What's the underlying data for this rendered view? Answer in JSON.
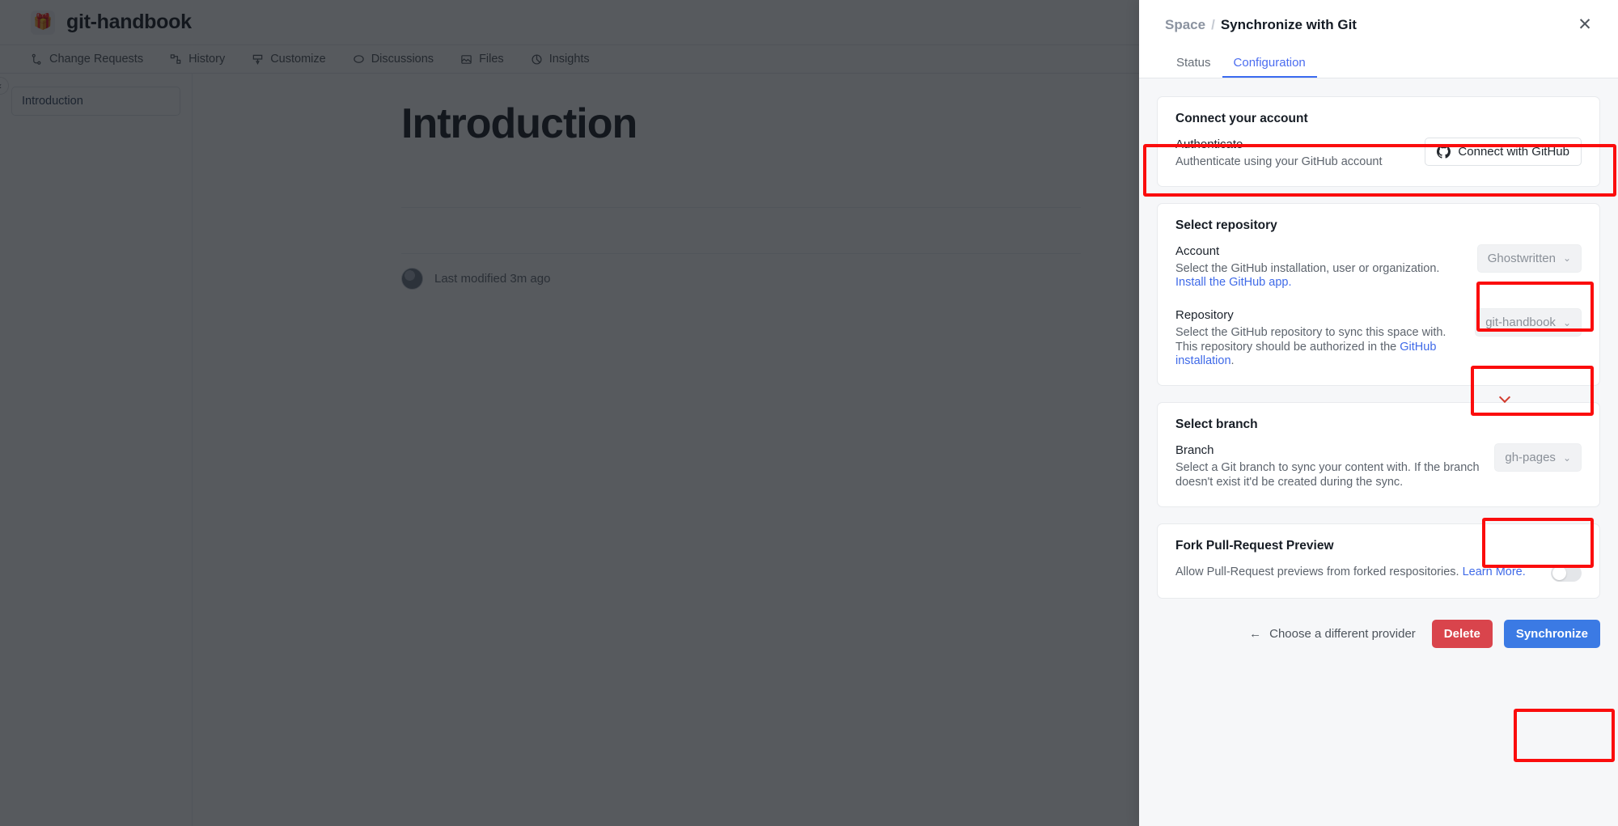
{
  "app": {
    "space_emoji": "🎁",
    "space_title": "git-handbook",
    "collapse_icon": "chevron-left-icon",
    "nav": [
      {
        "label": "Change Requests",
        "icon": "git-branch-icon"
      },
      {
        "label": "History",
        "icon": "history-nodes-icon"
      },
      {
        "label": "Customize",
        "icon": "paint-roller-icon"
      },
      {
        "label": "Discussions",
        "icon": "chat-bubble-icon"
      },
      {
        "label": "Files",
        "icon": "image-file-icon"
      },
      {
        "label": "Insights",
        "icon": "pie-chart-icon"
      }
    ],
    "sidebar": {
      "items": [
        {
          "label": "Introduction"
        }
      ]
    },
    "document": {
      "title": "Introduction",
      "last_modified": "Last modified 3m ago"
    }
  },
  "panel": {
    "breadcrumb": {
      "parent": "Space",
      "separator": "/",
      "current": "Synchronize with Git"
    },
    "close_icon": "close-icon",
    "tabs": [
      {
        "label": "Status",
        "active": false
      },
      {
        "label": "Configuration",
        "active": true
      }
    ],
    "connect_account": {
      "title": "Connect your account",
      "field_label": "Authenticate",
      "field_desc": "Authenticate using your GitHub account",
      "button_label": "Connect with GitHub",
      "button_icon": "github-mark-icon"
    },
    "select_repository": {
      "title": "Select repository",
      "account": {
        "label": "Account",
        "desc": "Select the GitHub installation, user or organization.",
        "link": "Install the GitHub app.",
        "value": "Ghostwritten",
        "caret_icon": "chevron-down-icon"
      },
      "repository": {
        "label": "Repository",
        "desc_part1": "Select the GitHub repository to sync this space with. This repository should be authorized in the ",
        "desc_link": "GitHub installation",
        "desc_part2": ".",
        "value": "git-handbook",
        "caret_icon": "chevron-down-icon"
      }
    },
    "select_branch": {
      "title": "Select branch",
      "branch": {
        "label": "Branch",
        "desc": "Select a Git branch to sync your content with. If the branch doesn't exist it'd be created during the sync.",
        "value": "gh-pages",
        "caret_icon": "chevron-down-icon"
      }
    },
    "fork_preview": {
      "title": "Fork Pull-Request Preview",
      "desc": "Allow Pull-Request previews from forked respositories.",
      "link": "Learn More.",
      "toggle_state": "off"
    },
    "footer": {
      "back_arrow_icon": "arrow-left-icon",
      "provider_label": "Choose a different provider",
      "delete_label": "Delete",
      "synchronize_label": "Synchronize"
    }
  },
  "colors": {
    "accent": "#3b7ae4",
    "danger": "#d9444c",
    "link": "#3f6ae8",
    "highlight": "#fb0d0d",
    "panel_bg": "#f6f7f9"
  }
}
